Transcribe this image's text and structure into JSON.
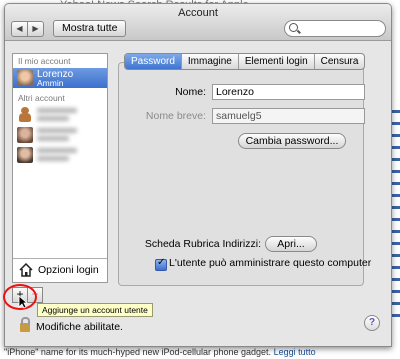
{
  "background": {
    "title": "Yahoo! News Search Results for Apple",
    "bottom_text": "\"iPhone\" name for its much-hyped new iPod-cellular phone gadget.",
    "bottom_link": "Leggi tutto"
  },
  "window": {
    "title": "Account",
    "back_arrow": "◀",
    "forward_arrow": "▶",
    "show_all_label": "Mostra tutte",
    "search_placeholder": ""
  },
  "sidebar": {
    "my_account_header": "Il mio account",
    "my_account": {
      "name": "Lorenzo",
      "role": "Ammin"
    },
    "other_accounts_header": "Altri account",
    "other_accounts_count": 3,
    "login_options_label": "Opzioni login"
  },
  "account_controls": {
    "add_label": "+",
    "remove_label": "−",
    "add_tooltip": "Aggiunge un account utente"
  },
  "tabs": [
    {
      "label": "Password",
      "active": true
    },
    {
      "label": "Immagine",
      "active": false
    },
    {
      "label": "Elementi login",
      "active": false
    },
    {
      "label": "Censura",
      "active": false
    }
  ],
  "form": {
    "name_label": "Nome:",
    "name_value": "Lorenzo",
    "short_name_label": "Nome breve:",
    "short_name_value": "samuelg5",
    "change_password_label": "Cambia password...",
    "address_book_label": "Scheda Rubrica Indirizzi:",
    "open_label": "Apri...",
    "admin_checkbox_label": "L'utente può amministrare questo computer",
    "admin_checked": true
  },
  "footer": {
    "lock_message": "Modifiche abilitate.",
    "help_label": "?"
  },
  "colors": {
    "selection": "#3c6fce",
    "annotation_ring": "#e11111"
  }
}
